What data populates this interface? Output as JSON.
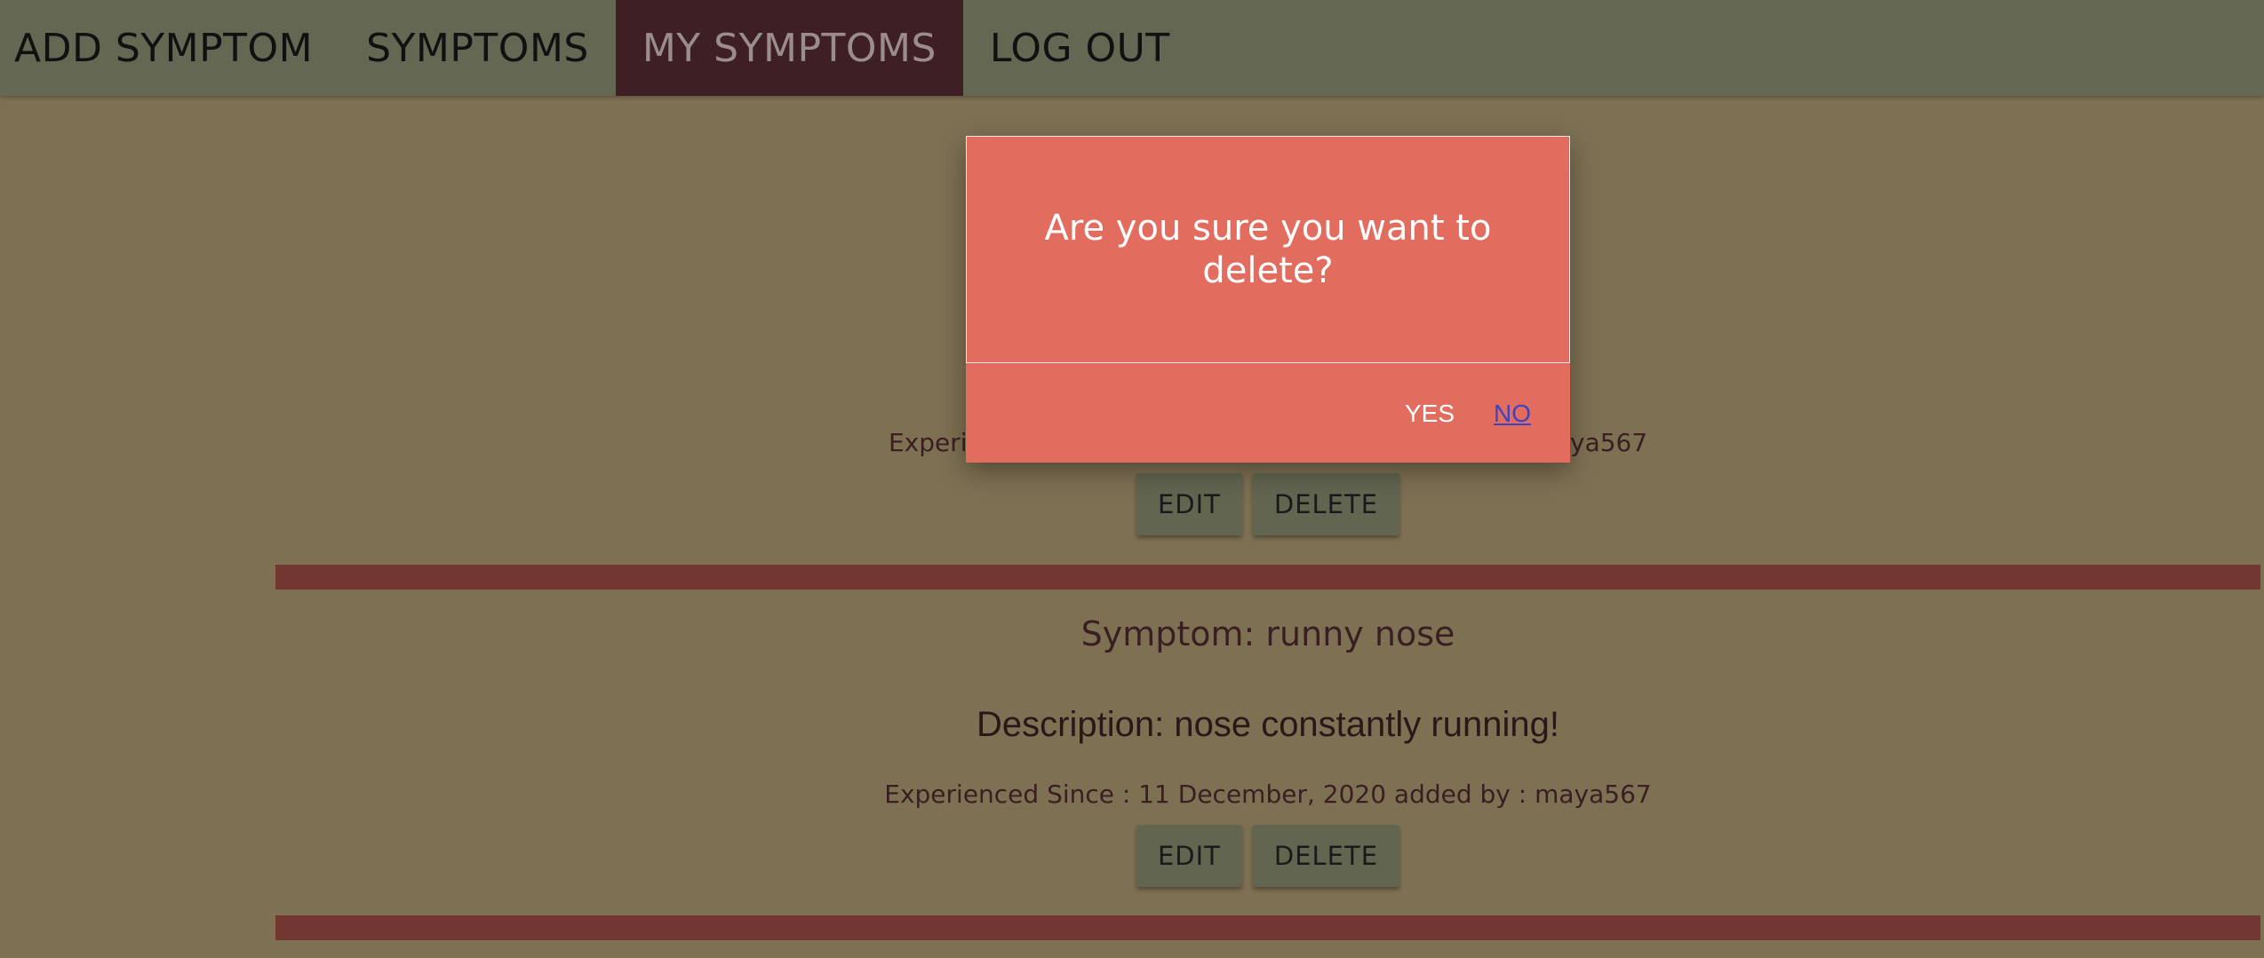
{
  "nav": {
    "items": [
      {
        "label": "ADD SYMPTOM"
      },
      {
        "label": "SYMPTOMS"
      },
      {
        "label": "MY SYMPTOMS",
        "active": true
      },
      {
        "label": "LOG OUT"
      }
    ]
  },
  "entries": [
    {
      "meta_partial_left": "Experi",
      "meta_partial_right": "ya567",
      "edit_label": "EDIT",
      "delete_label": "DELETE"
    },
    {
      "symptom": "Symptom: runny nose",
      "description": "Description: nose constantly running!",
      "meta": "Experienced Since : 11 December, 2020 added by : maya567",
      "edit_label": "EDIT",
      "delete_label": "DELETE"
    }
  ],
  "modal": {
    "message": "Are you sure you want to delete?",
    "yes_label": "YES",
    "no_label": "NO"
  },
  "colors": {
    "background": "#7e7053",
    "navbar": "#646751",
    "nav_active": "#3d1f24",
    "divider": "#733731",
    "modal": "#e26c5e",
    "button": "#626550"
  }
}
